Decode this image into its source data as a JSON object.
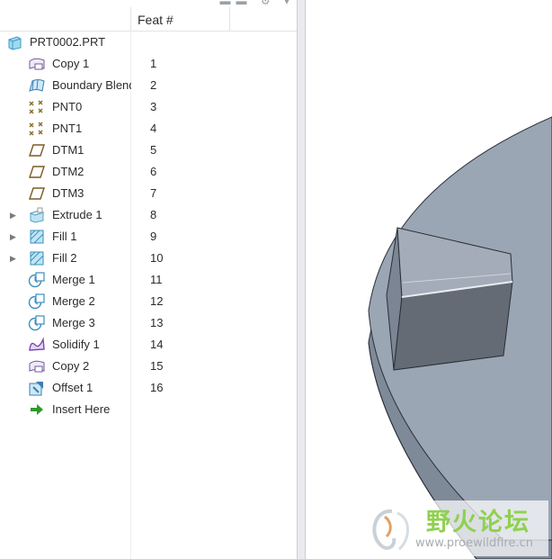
{
  "header": {
    "feat_col": "Feat #"
  },
  "root": {
    "label": "PRT0002.PRT",
    "icon": "part-icon"
  },
  "items": [
    {
      "label": "Copy 1",
      "feat": "1",
      "icon": "copy-surface-icon",
      "expandable": false
    },
    {
      "label": "Boundary Blend",
      "feat": "2",
      "icon": "boundary-blend-icon",
      "expandable": false
    },
    {
      "label": "PNT0",
      "feat": "3",
      "icon": "datum-point-icon",
      "expandable": false
    },
    {
      "label": "PNT1",
      "feat": "4",
      "icon": "datum-point-icon",
      "expandable": false
    },
    {
      "label": "DTM1",
      "feat": "5",
      "icon": "datum-plane-icon",
      "expandable": false
    },
    {
      "label": "DTM2",
      "feat": "6",
      "icon": "datum-plane-icon",
      "expandable": false
    },
    {
      "label": "DTM3",
      "feat": "7",
      "icon": "datum-plane-icon",
      "expandable": false
    },
    {
      "label": "Extrude 1",
      "feat": "8",
      "icon": "extrude-icon",
      "expandable": true
    },
    {
      "label": "Fill 1",
      "feat": "9",
      "icon": "fill-icon",
      "expandable": true
    },
    {
      "label": "Fill 2",
      "feat": "10",
      "icon": "fill-icon",
      "expandable": true
    },
    {
      "label": "Merge 1",
      "feat": "11",
      "icon": "merge-icon",
      "expandable": false
    },
    {
      "label": "Merge 2",
      "feat": "12",
      "icon": "merge-icon",
      "expandable": false
    },
    {
      "label": "Merge 3",
      "feat": "13",
      "icon": "merge-icon",
      "expandable": false
    },
    {
      "label": "Solidify 1",
      "feat": "14",
      "icon": "solidify-icon",
      "expandable": false
    },
    {
      "label": "Copy 2",
      "feat": "15",
      "icon": "copy-surface-icon",
      "expandable": false
    },
    {
      "label": "Offset 1",
      "feat": "16",
      "icon": "offset-icon",
      "expandable": false
    }
  ],
  "insert_here": {
    "label": "Insert Here",
    "icon": "insert-arrow-icon"
  },
  "watermark": {
    "chinese": "野火论坛",
    "url": "www.proewildfire.cn"
  },
  "colors": {
    "disk_top": "#9aa6b4",
    "disk_edge": "#7e8a98",
    "block_front": "#646b75",
    "block_left": "#7c8593",
    "block_top": "#a3acb8",
    "watermark_green": "#8fd14f"
  }
}
